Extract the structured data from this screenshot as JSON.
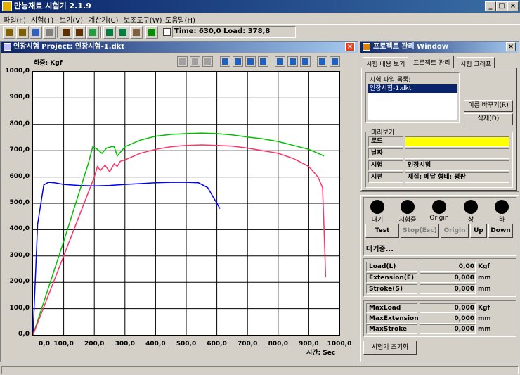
{
  "app": {
    "title": "만능재료 시험기 2.1.9"
  },
  "menu": [
    "파일(F)",
    "시험(T)",
    "보기(V)",
    "계산기(C)",
    "보조도구(W)",
    "도움말(H)"
  ],
  "toolbar": {
    "time_load": "Time: 630,0  Load: 378,8"
  },
  "chart_window": {
    "title": "인장시험 Project: 인장시험-1.dkt",
    "y_axis_label": "하중: Kgf",
    "x_axis_label": "시간: Sec"
  },
  "chart_data": {
    "type": "line",
    "xlim": [
      0,
      1000
    ],
    "ylim": [
      0,
      1000
    ],
    "x_ticks": [
      "0,0",
      "100,0",
      "200,0",
      "300,0",
      "400,0",
      "500,0",
      "600,0",
      "700,0",
      "800,0",
      "900,0",
      "1000,0"
    ],
    "y_ticks": [
      "0,0",
      "100,0",
      "200,0",
      "300,0",
      "400,0",
      "500,0",
      "600,0",
      "700,0",
      "800,0",
      "900,0",
      "1000,0"
    ],
    "grid": true,
    "series": [
      {
        "color": "#0000ff",
        "x": [
          0,
          15,
          35,
          50,
          70,
          100,
          150,
          200,
          250,
          300,
          350,
          400,
          450,
          500,
          540,
          570,
          590,
          600,
          610
        ],
        "y": [
          0,
          420,
          570,
          580,
          578,
          572,
          568,
          566,
          568,
          572,
          575,
          578,
          580,
          580,
          578,
          560,
          520,
          500,
          480
        ]
      },
      {
        "color": "#00c000",
        "x": [
          0,
          100,
          180,
          195,
          210,
          225,
          240,
          255,
          265,
          275,
          300,
          350,
          400,
          450,
          500,
          550,
          600,
          650,
          700,
          750,
          800,
          850,
          900,
          950
        ],
        "y": [
          0,
          355,
          650,
          715,
          705,
          690,
          710,
          715,
          715,
          680,
          715,
          740,
          755,
          762,
          765,
          767,
          765,
          760,
          752,
          745,
          735,
          720,
          705,
          680
        ]
      },
      {
        "color": "#ff3366",
        "x": [
          0,
          100,
          200,
          210,
          220,
          235,
          250,
          265,
          275,
          285,
          300,
          350,
          400,
          450,
          500,
          550,
          600,
          650,
          700,
          750,
          800,
          850,
          900,
          930,
          945,
          950,
          955
        ],
        "y": [
          0,
          300,
          600,
          640,
          625,
          645,
          620,
          650,
          640,
          660,
          665,
          690,
          705,
          715,
          720,
          722,
          720,
          717,
          710,
          700,
          690,
          670,
          640,
          600,
          560,
          400,
          220
        ]
      }
    ]
  },
  "project_window": {
    "title": "프로젝트 관리 Window",
    "tabs": [
      "시험 내용 보기",
      "프로젝트 관리",
      "시험 그래프"
    ],
    "file_group_label": "시험 파일 목록:",
    "files": [
      "인장시험-1.dkt"
    ],
    "rename_button": "이름 바꾸기(R)",
    "delete_button": "삭제(D)",
    "preview_label": "미리보기",
    "preview_rows": [
      {
        "label": "로드",
        "value": ""
      },
      {
        "label": "날짜",
        "value": ""
      },
      {
        "label": "시험",
        "value": "인장시험"
      },
      {
        "label": "시편",
        "value": "재질: 페달    형태: 평판"
      }
    ],
    "load_color": "#ffff00"
  },
  "status_panel": {
    "leds": [
      "대기",
      "시험중",
      "Origin",
      "상",
      "하"
    ],
    "buttons": [
      "Test",
      "Stop(Esc)",
      "Origin",
      "Up",
      "Down"
    ],
    "state_text": "대기중...",
    "readings": [
      {
        "label": "Load(L)",
        "value": "0,00",
        "unit": "Kgf"
      },
      {
        "label": "Extension(E)",
        "value": "0,000",
        "unit": "mm"
      },
      {
        "label": "Stroke(S)",
        "value": "0,000",
        "unit": "mm"
      }
    ],
    "max_readings": [
      {
        "label": "MaxLoad",
        "value": "0,000",
        "unit": "Kgf"
      },
      {
        "label": "MaxExtension",
        "value": "0,000",
        "unit": "mm"
      },
      {
        "label": "MaxStroke",
        "value": "0,000",
        "unit": "mm"
      }
    ],
    "reset_button": "시험기 초기화"
  }
}
